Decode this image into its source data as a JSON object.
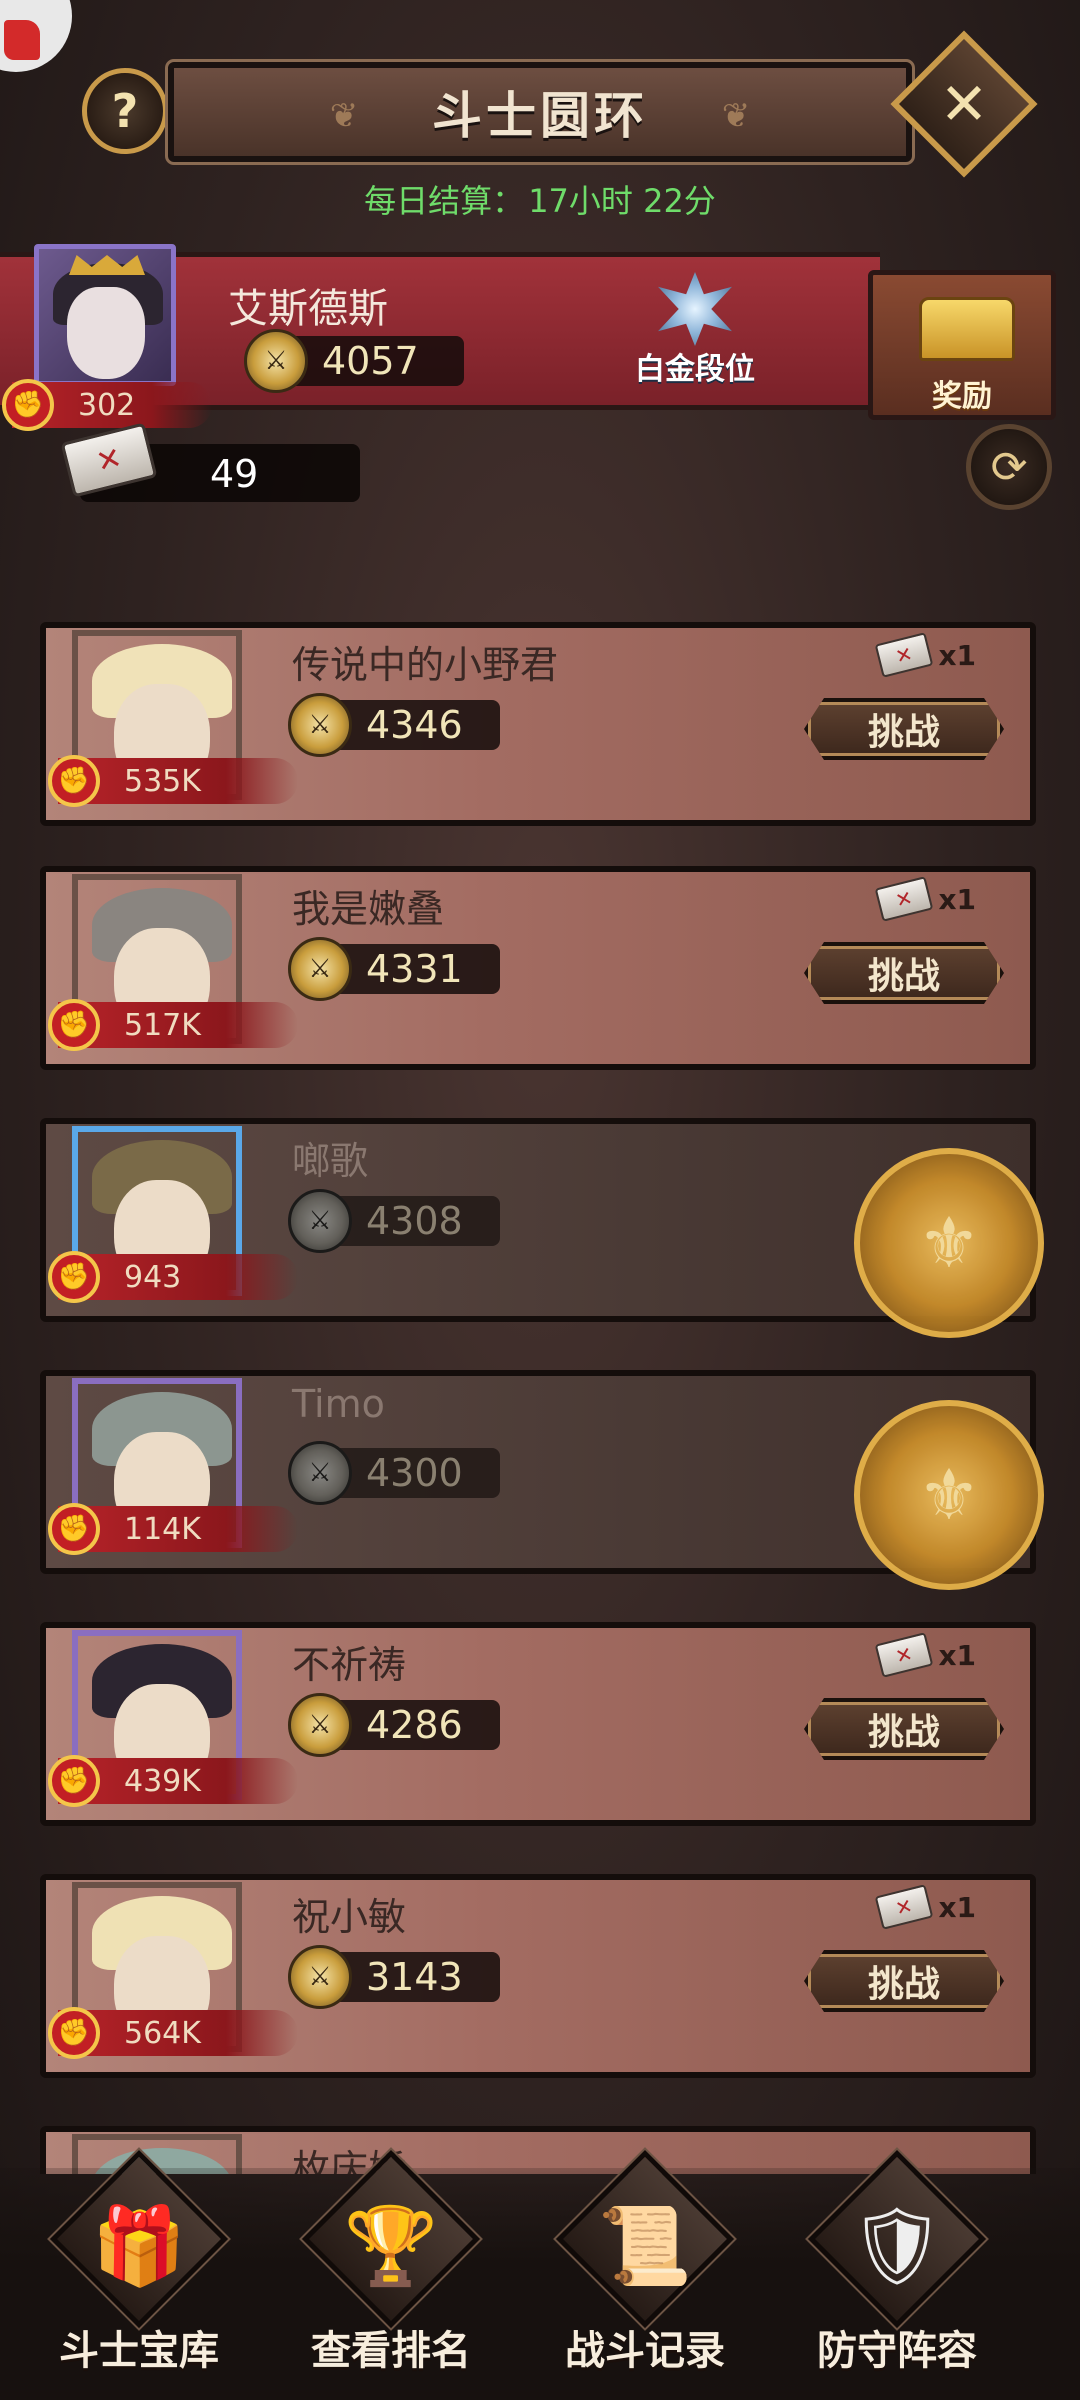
{
  "header": {
    "title": "斗士圆环",
    "help_label": "?",
    "close_label": "✕",
    "settle_prefix": "每日结算：",
    "settle_time": "17小时 22分"
  },
  "me": {
    "name": "艾斯德斯",
    "score": "4057",
    "power": "302",
    "rank": "白金段位",
    "reward_label": "奖励",
    "tickets": "49"
  },
  "opponents": [
    {
      "name": "传说中的小野君",
      "score": "4346",
      "power": "535K",
      "cost": "x1",
      "action": "挑战",
      "state": "available",
      "frame": "brown",
      "hair": "#f0e2b8"
    },
    {
      "name": "我是嫩叠",
      "score": "4331",
      "power": "517K",
      "cost": "x1",
      "action": "挑战",
      "state": "available",
      "frame": "brown",
      "hair": "#8a8580"
    },
    {
      "name": "啷歌",
      "score": "4308",
      "power": "943",
      "cost": "",
      "action": "",
      "state": "defeated",
      "frame": "blue",
      "hair": "#7a6a48"
    },
    {
      "name": "Timo",
      "score": "4300",
      "power": "114K",
      "cost": "",
      "action": "",
      "state": "defeated",
      "frame": "purple",
      "hair": "#8c9690"
    },
    {
      "name": "不祈祷",
      "score": "4286",
      "power": "439K",
      "cost": "x1",
      "action": "挑战",
      "state": "available",
      "frame": "purple",
      "hair": "#2c2530"
    },
    {
      "name": "祝小敏",
      "score": "3143",
      "power": "564K",
      "cost": "x1",
      "action": "挑战",
      "state": "available",
      "frame": "brown",
      "hair": "#efe1b4"
    },
    {
      "name": "枚庆娇",
      "score": "",
      "power": "",
      "cost": "",
      "action": "",
      "state": "partial",
      "frame": "brown",
      "hair": "#8fa8a0"
    }
  ],
  "nav": [
    {
      "label": "斗士宝库",
      "icon": "treasure-chest-icon",
      "glyph": "🎁"
    },
    {
      "label": "查看排名",
      "icon": "trophy-icon",
      "glyph": "🏆"
    },
    {
      "label": "战斗记录",
      "icon": "scroll-icon",
      "glyph": "📜"
    },
    {
      "label": "防守阵容",
      "icon": "shield-icon",
      "glyph": "🛡"
    }
  ],
  "colors": {
    "accent_gold": "#c99a4a",
    "player_panel": "#a1323a",
    "settle_green": "#6fdc6a",
    "card_bg": "#a36c62"
  }
}
